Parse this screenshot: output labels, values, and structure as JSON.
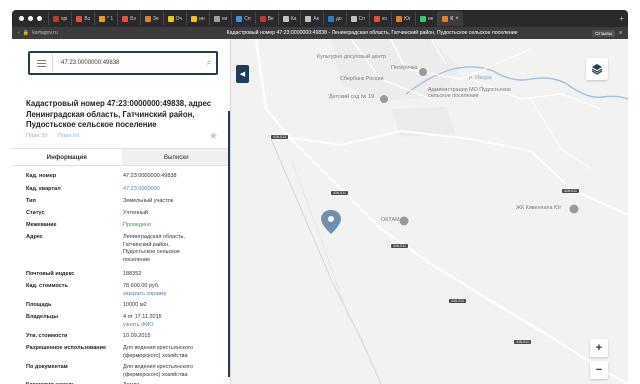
{
  "browser": {
    "tabs": [
      {
        "label": "spi",
        "color": "#c0392b"
      },
      {
        "label": "Вз",
        "color": "#e74c3c"
      },
      {
        "label": "* 1",
        "color": "#f39c12"
      },
      {
        "label": "Вз",
        "color": "#e74c3c"
      },
      {
        "label": "Зе",
        "color": "#e67e22"
      },
      {
        "label": "Оч",
        "color": "#f1c40f"
      },
      {
        "label": "ин",
        "color": "#f1c40f"
      },
      {
        "label": "ни",
        "color": "#95a5a6"
      },
      {
        "label": "Сп",
        "color": "#3498db"
      },
      {
        "label": "Ве",
        "color": "#c0392b"
      },
      {
        "label": "Ка",
        "color": "#bdc3c7"
      },
      {
        "label": "Ак",
        "color": "#bdc3c7"
      },
      {
        "label": "до",
        "color": "#2980b9"
      },
      {
        "label": "Сп",
        "color": "#bdc3c7"
      },
      {
        "label": "ко",
        "color": "#e74c3c"
      },
      {
        "label": "Юг",
        "color": "#e67e22"
      },
      {
        "label": "не",
        "color": "#2ecc71"
      }
    ],
    "active_tab": {
      "label": "К",
      "color": "#e67e22"
    },
    "url": "kartagov.ru",
    "page_title": "Кадастровый номер 47:23:0000000:49838 - Ленинградская область, Гатчинский район, Пудостьское сельское поселение",
    "badge": "Отзывы"
  },
  "search": {
    "value": "47:23:0000000:49838"
  },
  "object": {
    "title": "Кадастровый номер 47:23:0000000:49838, адрес Ленинградская область, Гатчинский район, Пудостьское сельское поселение",
    "plan_zu": "План ЗУ",
    "plan_kk": "План КК"
  },
  "panel_tabs": {
    "info": "Информация",
    "extracts": "Выписки"
  },
  "properties": [
    {
      "key": "Кад. номер",
      "value": [
        "47:23:0000000:49838"
      ],
      "style": ""
    },
    {
      "key": "Кад. квартал",
      "value": [
        "47:23:0000000"
      ],
      "style": "link"
    },
    {
      "key": "Тип",
      "value": [
        "Земельный участок"
      ],
      "style": ""
    },
    {
      "key": "Статус",
      "value": [
        "Учтенный"
      ],
      "style": ""
    },
    {
      "key": "Межевание",
      "value": [
        "Проведено"
      ],
      "style": "green"
    },
    {
      "key": "Адрес",
      "value": [
        "Ленинградская область,",
        "Гатчинский район,",
        "Пудостьское сельское",
        "поселение"
      ],
      "style": ""
    },
    {
      "key": "Почтовый индекс",
      "value": [
        "188352"
      ],
      "style": ""
    },
    {
      "key": "Кад. стоимость",
      "value": [
        "78,600.00 руб."
      ],
      "extra": "заказать справку",
      "style": ""
    },
    {
      "key": "Площадь",
      "value": [
        "10000 м2"
      ],
      "style": ""
    },
    {
      "key": "Владельцы",
      "value": [
        "4 от 17.11.2015"
      ],
      "extra": "узнать ФИО",
      "style": ""
    },
    {
      "key": "Утв. стоимости",
      "value": [
        "10.09.2015"
      ],
      "style": ""
    },
    {
      "key": "Разрешенное использование",
      "value": [
        "Для ведения крестьянского",
        "(фермерского) хозяйства"
      ],
      "style": ""
    },
    {
      "key": "По документам",
      "value": [
        "Для ведения крестьянского",
        "(фермерского) хозяйства"
      ],
      "style": ""
    },
    {
      "key": "Категория земель",
      "value": [
        "Земли"
      ],
      "style": ""
    }
  ],
  "map": {
    "labels": {
      "culture": "Культурно досуговый центр",
      "pyaterochka": "Пятёрочка",
      "sberbank": "Сбербанк России",
      "admin": "Администрация МО Пудостьское сельское поселение",
      "kindergarten": "Детский сад № 19",
      "river": "р. Ижора",
      "oktam": "ОКТАМ",
      "kivennapa": "ЖК Кивеннапа Юг"
    },
    "road_tags": [
      "41К-013",
      "41К-011",
      "41К-011",
      "41К-011",
      "41К-011",
      "41К-011"
    ],
    "zoom_in": "+",
    "zoom_out": "−"
  }
}
